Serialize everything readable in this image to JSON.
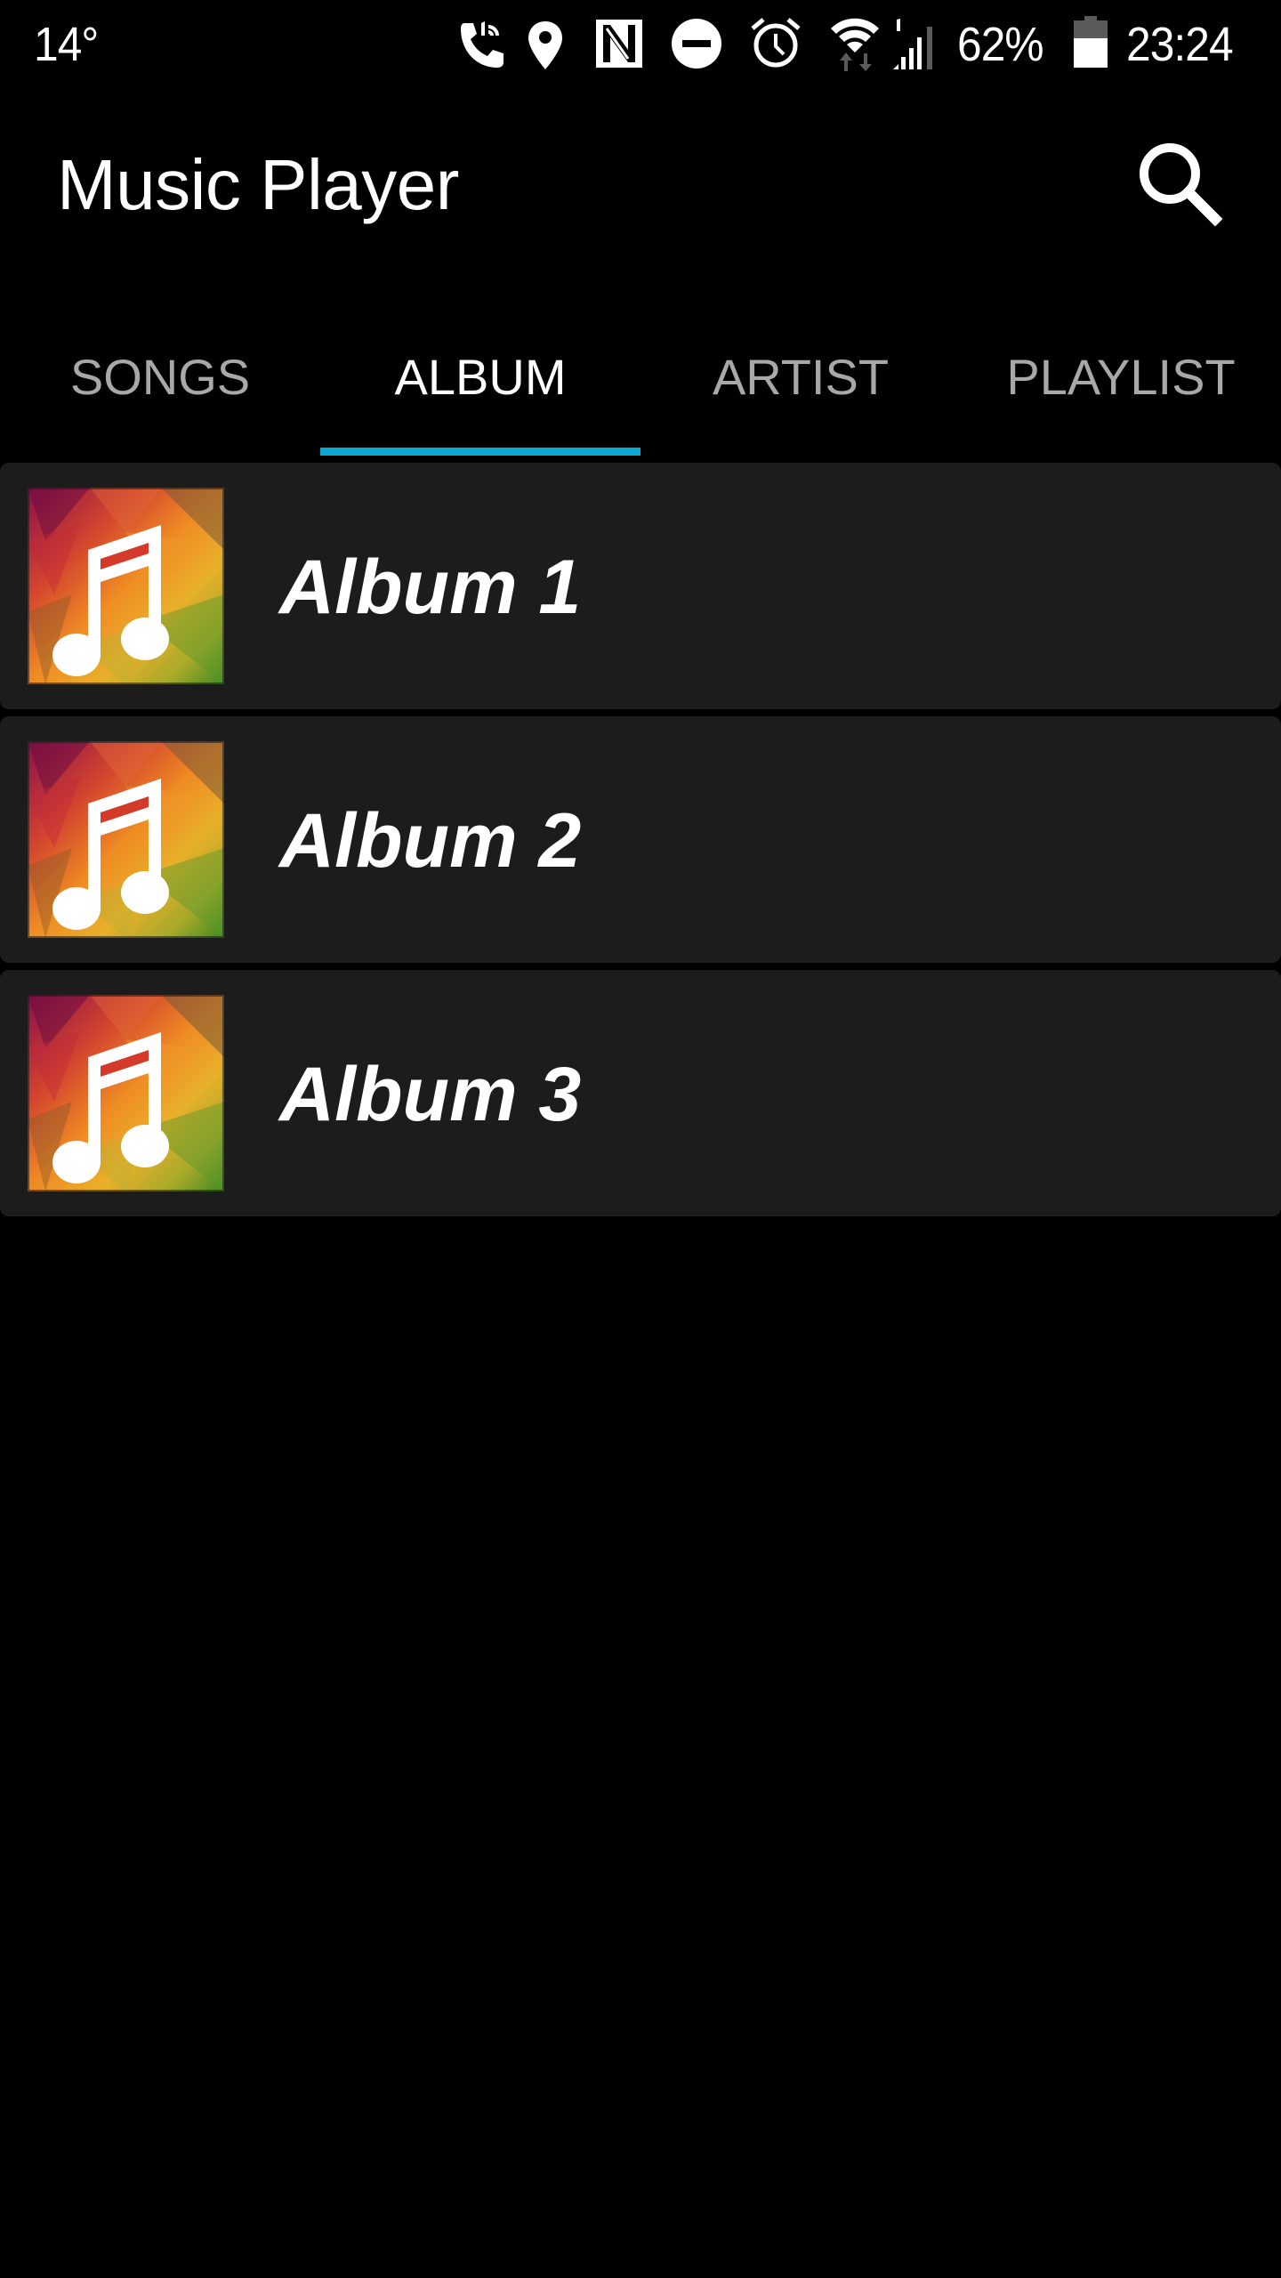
{
  "status_bar": {
    "temperature": "14°",
    "battery_percent_text": "62%",
    "battery_level": 0.62,
    "time": "23:24",
    "icons": [
      "wifi-calling-icon",
      "location-icon",
      "nfc-icon",
      "do-not-disturb-icon",
      "alarm-icon",
      "wifi-icon",
      "cell-signal-icon",
      "battery-icon"
    ]
  },
  "app_bar": {
    "title": "Music Player",
    "search_icon": "search-icon"
  },
  "tabs": [
    {
      "label": "SONGS",
      "active": false
    },
    {
      "label": "ALBUM",
      "active": true
    },
    {
      "label": "ARTIST",
      "active": false
    },
    {
      "label": "PLAYLIST",
      "active": false
    }
  ],
  "albums": [
    {
      "name": "Album 1",
      "art_icon": "music-note-icon"
    },
    {
      "name": "Album 2",
      "art_icon": "music-note-icon"
    },
    {
      "name": "Album 3",
      "art_icon": "music-note-icon"
    }
  ],
  "colors": {
    "background": "#000000",
    "card": "#1c1c1c",
    "accent": "#0aa9d4",
    "tab_inactive": "#a8a8a8",
    "tab_active": "#ffffff"
  }
}
